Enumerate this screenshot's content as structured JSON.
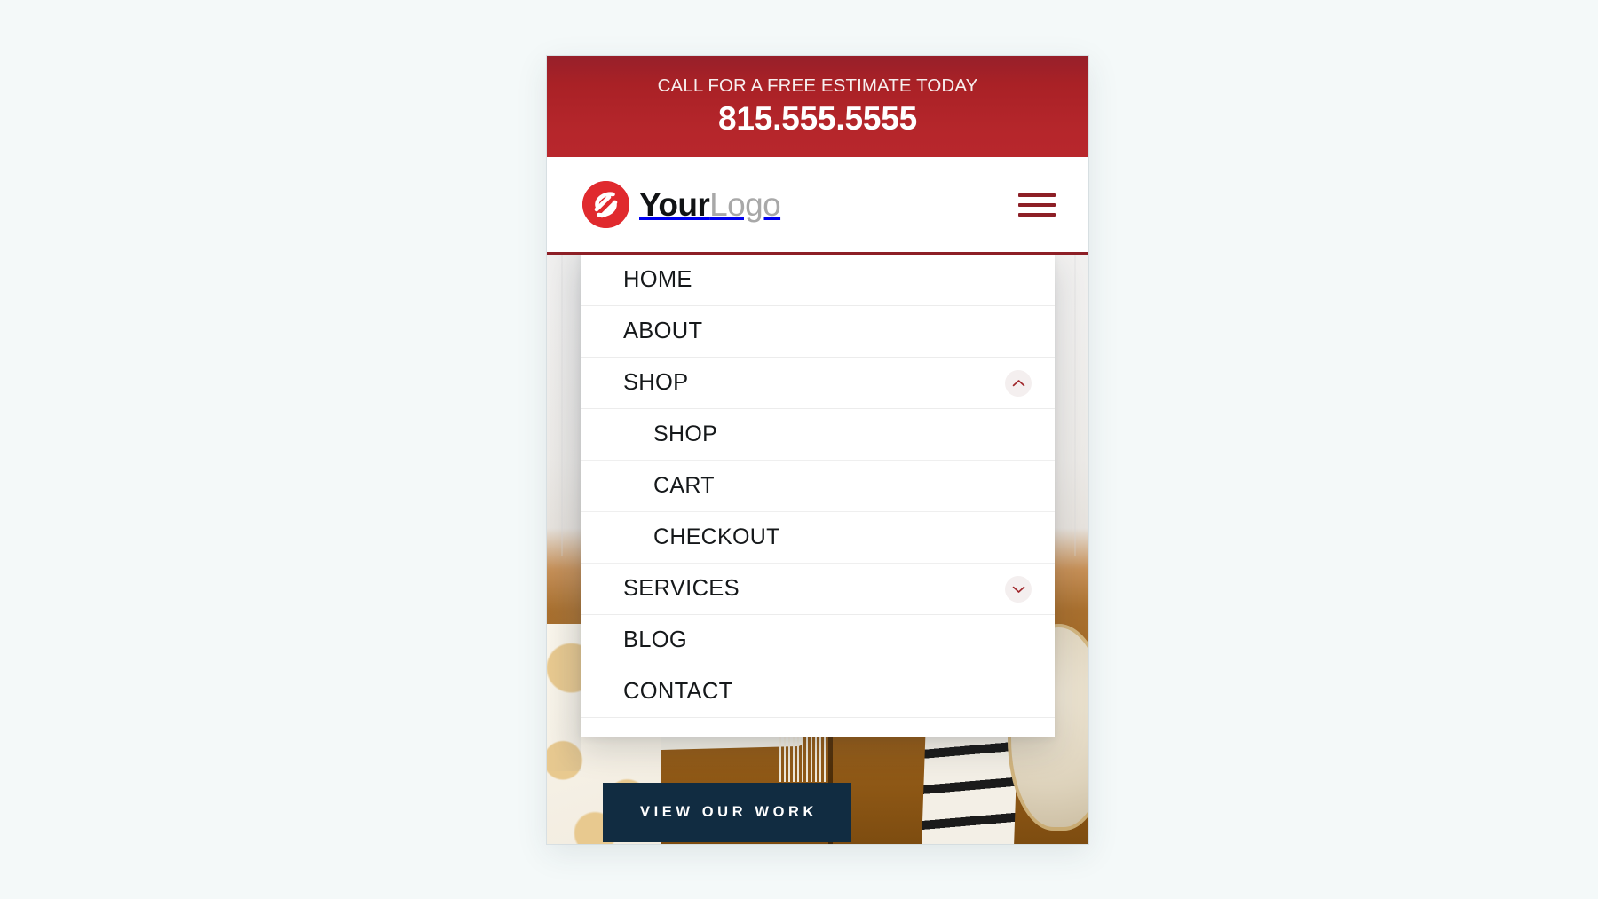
{
  "page": {
    "background_color": "#f4f9f9"
  },
  "callbar": {
    "headline": "CALL FOR A FREE ESTIMATE TODAY",
    "phone": "815.555.5555",
    "background_color": "#a92126"
  },
  "header": {
    "logo": {
      "mark_name": "swirl-logo-mark",
      "mark_color": "#e02a2e",
      "text_primary": "Your",
      "text_secondary": "Logo"
    },
    "menu_button": {
      "icon": "hamburger-icon",
      "color": "#8d1f26",
      "label": "Menu"
    },
    "border_color": "#8d1f26"
  },
  "nav": {
    "items": [
      {
        "label": "HOME",
        "level": 1,
        "toggle": null
      },
      {
        "label": "ABOUT",
        "level": 1,
        "toggle": null
      },
      {
        "label": "SHOP",
        "level": 1,
        "toggle": "chevron-up-icon",
        "expanded": true
      },
      {
        "label": "SHOP",
        "level": 2,
        "toggle": null
      },
      {
        "label": "CART",
        "level": 2,
        "toggle": null
      },
      {
        "label": "CHECKOUT",
        "level": 2,
        "toggle": null
      },
      {
        "label": "SERVICES",
        "level": 1,
        "toggle": "chevron-down-icon",
        "expanded": false
      },
      {
        "label": "BLOG",
        "level": 1,
        "toggle": null
      },
      {
        "label": "CONTACT",
        "level": 1,
        "toggle": null
      }
    ],
    "toggle_color": "#a0282c",
    "toggle_bg": "#f4efef"
  },
  "hero": {
    "cta_label": "VIEW OUR WORK",
    "cta_background": "#112c41",
    "cta_text_color": "#ffffff",
    "image_description": "living room with tan leather sofa and decorative pillows"
  }
}
